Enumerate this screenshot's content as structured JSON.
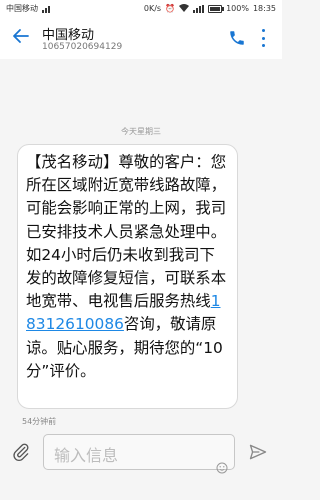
{
  "status_bar": {
    "carrier": "中国移动",
    "net_speed": "0K/s",
    "battery": "100%",
    "battery_level": 1.0,
    "time": "18:35"
  },
  "header": {
    "title": "中国移动",
    "number": "10657020694129"
  },
  "conversation": {
    "date_divider": "今天星期三",
    "message": {
      "text_before": "【茂名移动】尊敬的客户：您所在区域附近宽带线路故障，可能会影响正常的上网，我司已安排技术人员紧急处理中。如24小时后仍未收到我司下发的故障修复短信，可联系本地宽带、电视售后服务热线",
      "phone": "18312610086",
      "text_after": "咨询，敬请原谅。贴心服务，期待您的“10分”评价。",
      "time": "54分钟前"
    }
  },
  "input": {
    "placeholder": "输入信息"
  },
  "colors": {
    "accent": "#1976d2",
    "link": "#1e88e5"
  },
  "icons": {
    "back": "back-arrow-icon",
    "call": "phone-icon",
    "more": "more-vertical-icon",
    "attach": "paperclip-icon",
    "emoji": "emoji-icon",
    "send": "send-icon"
  }
}
